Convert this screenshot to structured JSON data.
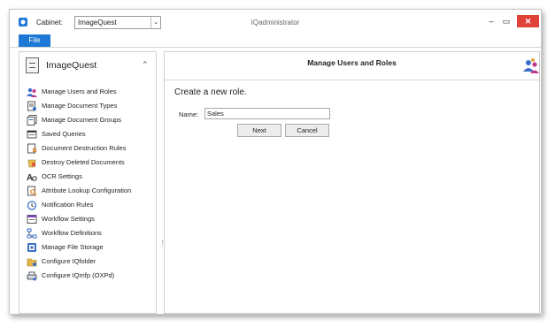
{
  "titlebar": {
    "cabinet_label": "Cabinet:",
    "cabinet_value": "ImageQuest",
    "window_title": "IQadministrator",
    "minimize_glyph": "–",
    "maximize_glyph": "▭",
    "close_glyph": "✕",
    "dropdown_glyph": "⌄"
  },
  "ribbon": {
    "file_tab": "File"
  },
  "nav": {
    "header_title": "ImageQuest",
    "collapse_glyph": "⌃",
    "items": [
      {
        "label": "Manage Users and Roles",
        "icon": "users-roles-icon"
      },
      {
        "label": "Manage Document Types",
        "icon": "document-types-icon"
      },
      {
        "label": "Manage Document Groups",
        "icon": "document-groups-icon"
      },
      {
        "label": "Saved Queries",
        "icon": "saved-queries-icon"
      },
      {
        "label": "Document Destruction Rules",
        "icon": "destruction-rules-icon"
      },
      {
        "label": "Destroy Deleted Documents",
        "icon": "destroy-deleted-icon"
      },
      {
        "label": "OCR Settings",
        "icon": "ocr-icon"
      },
      {
        "label": "Attribute Lookup Configuration",
        "icon": "attribute-lookup-icon"
      },
      {
        "label": "Notification Rules",
        "icon": "notification-clock-icon"
      },
      {
        "label": "Workflow Settings",
        "icon": "workflow-settings-icon"
      },
      {
        "label": "Workflow Definitions",
        "icon": "workflow-definitions-icon"
      },
      {
        "label": "Manage File Storage",
        "icon": "file-storage-icon"
      },
      {
        "label": "Configure IQfolder",
        "icon": "iqfolder-icon"
      },
      {
        "label": "Configure IQmfp (OXPd)",
        "icon": "iqmfp-icon"
      }
    ],
    "splitter_glyph": "⋮"
  },
  "main": {
    "title": "Manage Users and Roles",
    "prompt": "Create a new role.",
    "name_label": "Name:",
    "name_value": "Sales",
    "next_label": "Next",
    "cancel_label": "Cancel"
  },
  "colors": {
    "accent": "#1e78d6",
    "close_button": "#e0433a"
  }
}
